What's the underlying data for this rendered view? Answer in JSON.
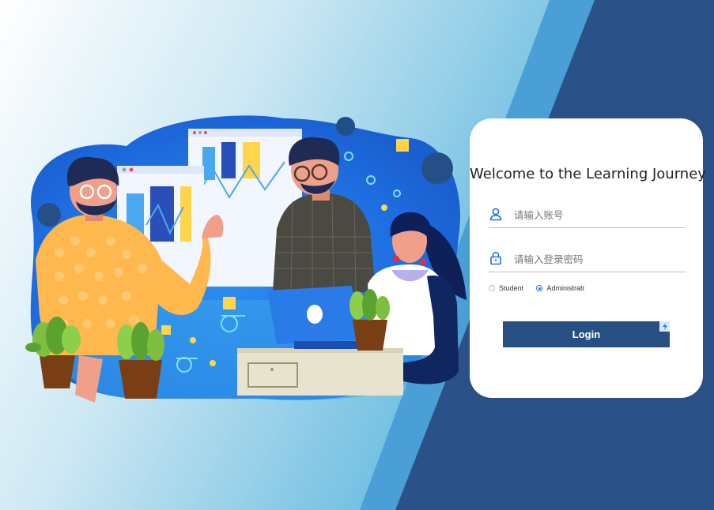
{
  "login": {
    "title": "Welcome to the Learning Journey",
    "username_placeholder": "请输入账号",
    "password_placeholder": "请输入登录密码",
    "roles": [
      {
        "label": "Student",
        "selected": false
      },
      {
        "label": "Administrator",
        "selected": true
      }
    ],
    "submit_label": "Login"
  },
  "icons": {
    "username": "user-icon",
    "password": "lock-icon",
    "button_badge": "lightning-icon"
  },
  "colors": {
    "accent": "#284f84",
    "panel_dark": "#2b5288",
    "panel_light": "#4a9fd6",
    "radio_active": "#1e73e8"
  }
}
